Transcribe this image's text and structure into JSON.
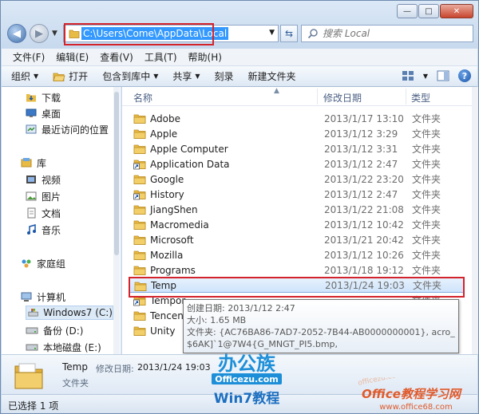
{
  "window": {
    "caption_buttons": {
      "minimize": "—",
      "maximize": "□",
      "close": "✕"
    }
  },
  "nav": {
    "address": "C:\\Users\\Come\\AppData\\Local",
    "search_placeholder": "搜索 Local"
  },
  "menubar": {
    "items": [
      "文件(F)",
      "编辑(E)",
      "查看(V)",
      "工具(T)",
      "帮助(H)"
    ]
  },
  "toolbar": {
    "organize": "组织",
    "open": "打开",
    "include_in_library": "包含到库中",
    "share": "共享",
    "burn": "刻录",
    "new_folder": "新建文件夹"
  },
  "navpane": {
    "items": [
      {
        "label": "下载",
        "icon": "downloads-folder-icon"
      },
      {
        "label": "桌面",
        "icon": "desktop-icon"
      },
      {
        "label": "最近访问的位置",
        "icon": "recent-places-icon"
      },
      {
        "label": "库",
        "icon": "libraries-icon"
      },
      {
        "label": "视频",
        "icon": "videos-icon"
      },
      {
        "label": "图片",
        "icon": "pictures-icon"
      },
      {
        "label": "文档",
        "icon": "documents-icon"
      },
      {
        "label": "音乐",
        "icon": "music-icon"
      },
      {
        "label": "家庭组",
        "icon": "homegroup-icon"
      },
      {
        "label": "计算机",
        "icon": "computer-icon"
      },
      {
        "label": "Windows7 (C:)",
        "icon": "windows-drive-icon"
      },
      {
        "label": "备份 (D:)",
        "icon": "drive-icon"
      },
      {
        "label": "本地磁盘 (E:)",
        "icon": "drive-icon"
      }
    ]
  },
  "columns": {
    "name": "名称",
    "date": "修改日期",
    "type": "类型"
  },
  "files": [
    {
      "name": "Adobe",
      "date": "2013/1/17 13:10",
      "type": "文件夹",
      "shortcut": false
    },
    {
      "name": "Apple",
      "date": "2013/1/12 3:29",
      "type": "文件夹",
      "shortcut": false
    },
    {
      "name": "Apple Computer",
      "date": "2013/1/12 3:31",
      "type": "文件夹",
      "shortcut": false
    },
    {
      "name": "Application Data",
      "date": "2013/1/12 2:47",
      "type": "文件夹",
      "shortcut": true
    },
    {
      "name": "Google",
      "date": "2013/1/22 23:20",
      "type": "文件夹",
      "shortcut": false
    },
    {
      "name": "History",
      "date": "2013/1/12 2:47",
      "type": "文件夹",
      "shortcut": true
    },
    {
      "name": "JiangShen",
      "date": "2013/1/22 21:08",
      "type": "文件夹",
      "shortcut": false
    },
    {
      "name": "Macromedia",
      "date": "2013/1/12 10:42",
      "type": "文件夹",
      "shortcut": false
    },
    {
      "name": "Microsoft",
      "date": "2013/1/21 20:42",
      "type": "文件夹",
      "shortcut": false
    },
    {
      "name": "Mozilla",
      "date": "2013/1/12 10:26",
      "type": "文件夹",
      "shortcut": false
    },
    {
      "name": "Programs",
      "date": "2013/1/18 19:12",
      "type": "文件夹",
      "shortcut": false
    },
    {
      "name": "Temp",
      "date": "2013/1/24 19:03",
      "type": "文件夹",
      "shortcut": false,
      "selected": true
    },
    {
      "name": "Tempor",
      "date": "",
      "type": "文件夹",
      "shortcut": true
    },
    {
      "name": "Tencent",
      "date": "",
      "type": "",
      "shortcut": false
    },
    {
      "name": "Unity",
      "date": "",
      "type": "",
      "shortcut": false
    }
  ],
  "tooltip": {
    "line1": "创建日期: 2013/1/12 2:47",
    "line2": "大小: 1.65 MB",
    "line3": "文件夹: {AC76BA86-7AD7-2052-7B44-AB0000000001}, acro_rd_dir,",
    "line4": "$6AK]`1@7W4{G_MNGT_PI5.bmp,"
  },
  "details": {
    "name": "Temp",
    "date_label": "修改日期:",
    "date": "2013/1/24 19:03",
    "type": "文件夹"
  },
  "status": {
    "text": "已选择 1 项"
  },
  "watermarks": {
    "logo_top": "办公族",
    "logo_mid": "Officezu.com",
    "logo_bottom": "Win7教程",
    "site_title": "Office教程学习网",
    "site_url": "www.office68.com",
    "diag": "officezu.com"
  },
  "colors": {
    "selection": "#cfe4fb",
    "highlight_box": "#d4232b",
    "address_selection": "#3399ff"
  }
}
